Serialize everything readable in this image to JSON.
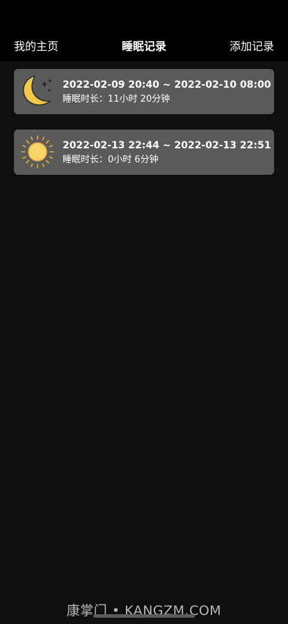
{
  "header": {
    "left_label": "我的主页",
    "title": "睡眠记录",
    "right_label": "添加记录"
  },
  "records": [
    {
      "icon": "moon-icon",
      "range": "2022-02-09 20:40 ~ 2022-02-10 08:00",
      "duration": "睡眠时长：11小时 20分钟"
    },
    {
      "icon": "sun-icon",
      "range": "2022-02-13 22:44 ~ 2022-02-13 22:51",
      "duration": "睡眠时长：0小时 6分钟"
    }
  ],
  "watermark": "康掌门 • KANGZM.COM",
  "colors": {
    "background": "#0f0f10",
    "header": "#000000",
    "card": "#5a5a5a",
    "moon": "#f5c74a",
    "sun": "#f7d36a"
  }
}
